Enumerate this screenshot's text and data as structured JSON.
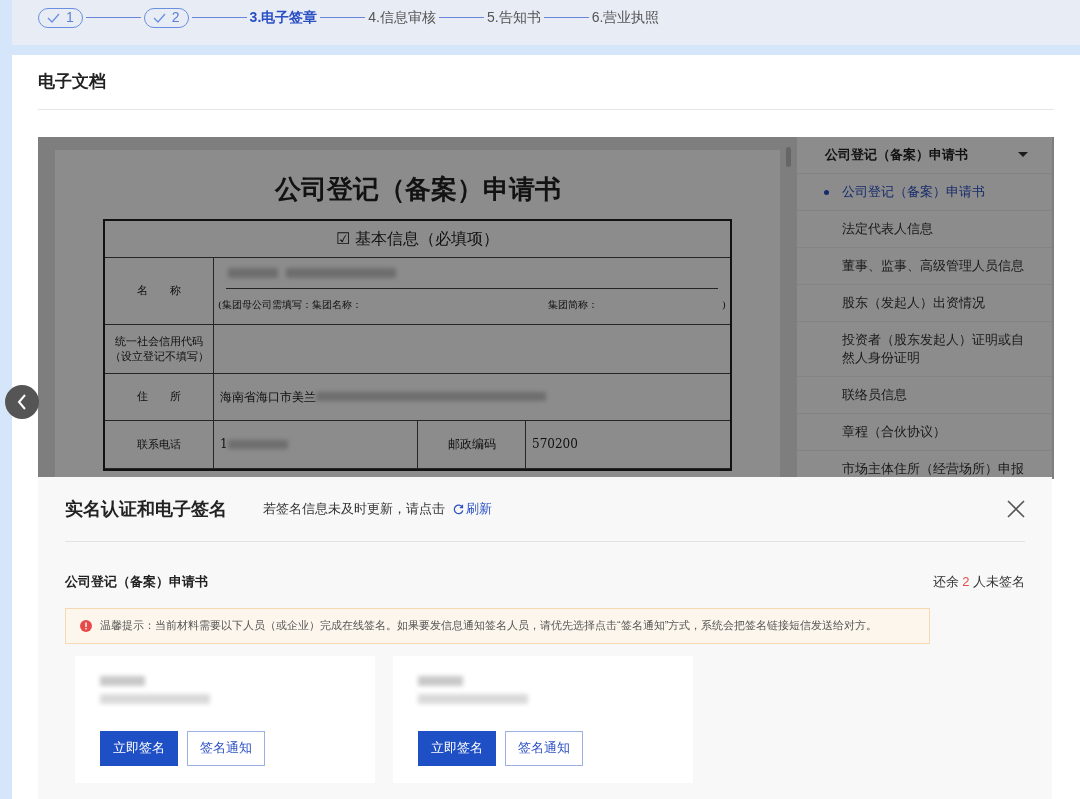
{
  "steps": [
    {
      "label": "1",
      "kind": "done"
    },
    {
      "label": "2",
      "kind": "done"
    },
    {
      "label": "3.电子签章",
      "kind": "current"
    },
    {
      "label": "4.信息审核",
      "kind": "pending"
    },
    {
      "label": "5.告知书",
      "kind": "pending"
    },
    {
      "label": "6.营业执照",
      "kind": "pending"
    }
  ],
  "section_title": "电子文档",
  "document": {
    "title": "公司登记（备案）申请书",
    "heading": "☑ 基本信息（必填项）",
    "name_label": "名　　称",
    "group_note": "(集团母公司需填写：集团名称：",
    "group_short": "集团简称：",
    "group_close": ")",
    "credit_label": "统一社会信用代码（设立登记不填写）",
    "address_label": "住　　所",
    "address_value": "海南省海口市美兰",
    "phone_label": "联系电话",
    "phone_value": "1",
    "postcode_label": "邮政编码",
    "postcode_value": "570200"
  },
  "outline": {
    "header": "公司登记（备案）申请书",
    "items": [
      {
        "label": "公司登记（备案）申请书",
        "selected": true
      },
      {
        "label": "法定代表人信息",
        "selected": false
      },
      {
        "label": "董事、监事、高级管理人员信息",
        "selected": false
      },
      {
        "label": "股东（发起人）出资情况",
        "selected": false
      },
      {
        "label": "投资者（股东发起人）证明或自然人身份证明",
        "selected": false
      },
      {
        "label": "联络员信息",
        "selected": false
      },
      {
        "label": "章程（合伙协议）",
        "selected": false
      },
      {
        "label": "市场主体住所（经营场所）申报",
        "selected": false
      }
    ]
  },
  "sign_panel": {
    "title": "实名认证和电子签名",
    "hint": "若签名信息未及时更新，请点击",
    "refresh": "刷新",
    "document_name": "公司登记（备案）申请书",
    "remaining_prefix": "还余",
    "remaining_count": "2",
    "remaining_suffix": "人未签名",
    "notice": "温馨提示：当前材料需要以下人员（或企业）完成在线签名。如果要发信息通知签名人员，请优先选择点击“签名通知”方式，系统会把签名链接短信发送给对方。",
    "signers": [
      {
        "sign_button": "立即签名",
        "notify_button": "签名通知"
      },
      {
        "sign_button": "立即签名",
        "notify_button": "签名通知"
      }
    ]
  }
}
